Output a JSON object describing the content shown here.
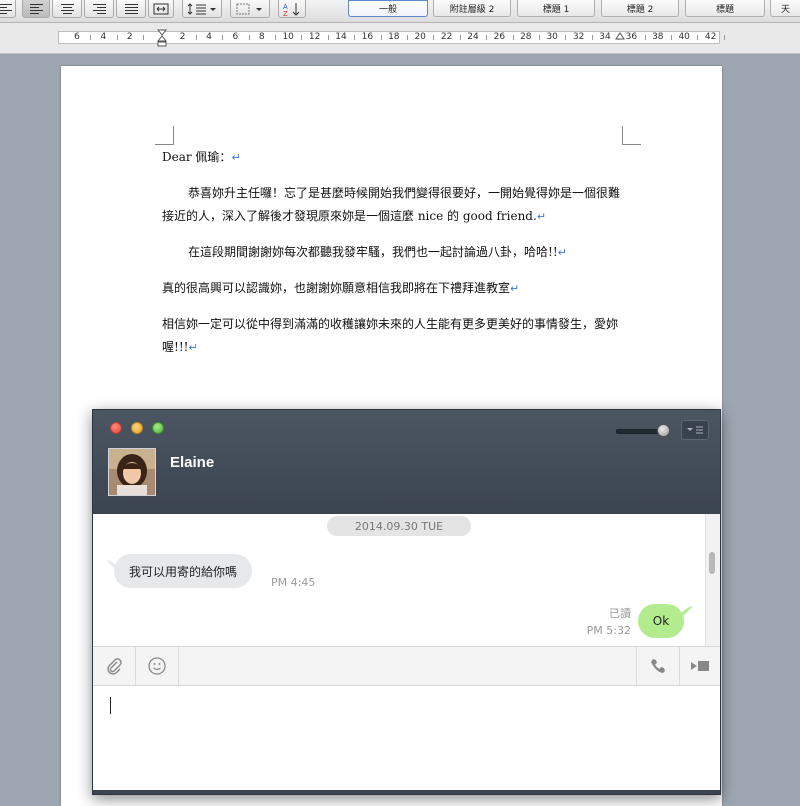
{
  "toolbar": {
    "styles": [
      "一般",
      "附註層級 2",
      "標題 1",
      "標題 2",
      "標題"
    ],
    "overflow_glyph": "天"
  },
  "ruler": {
    "labels": [
      "6",
      "4",
      "2",
      "2",
      "4",
      "6",
      "8",
      "10",
      "12",
      "14",
      "16",
      "18",
      "20",
      "22",
      "24",
      "26",
      "28",
      "30",
      "32",
      "34",
      "36",
      "38",
      "40",
      "42"
    ]
  },
  "document": {
    "greeting": "Dear  佩瑜：",
    "paragraphs": [
      "恭喜妳升主任囉！忘了是甚麼時候開始我們變得很要好，一開始覺得妳是一個很難接近的人，深入了解後才發現原來妳是一個這麼 nice 的 good friend.",
      "在這段期間謝謝妳每次都聽我發牢騷，我們也一起討論過八卦，哈哈!!",
      "真的很高興可以認識妳，也謝謝妳願意相信我即將在下禮拜進教室",
      "相信妳一定可以從中得到滿滿的收穫讓妳未來的人生能有更多更美好的事情發生，愛妳喔!!!"
    ],
    "paragraph_mark": "↵"
  },
  "chat": {
    "contact_name": "Elaine",
    "date_divider": "2014.09.30 TUE",
    "messages": [
      {
        "direction": "in",
        "text": "我可以用寄的給你嗎",
        "time": "PM 4:45"
      },
      {
        "direction": "out",
        "text": "Ok",
        "time": "PM 5:32",
        "status": "已讀"
      }
    ],
    "input_value": "",
    "colors": {
      "header": "#434c58",
      "outgoing_bubble": "#b2ec8e",
      "incoming_bubble": "#e6e8ea"
    },
    "icons": [
      "paperclip-icon",
      "emoji-icon",
      "phone-icon",
      "video-call-icon",
      "menu-icon"
    ]
  }
}
